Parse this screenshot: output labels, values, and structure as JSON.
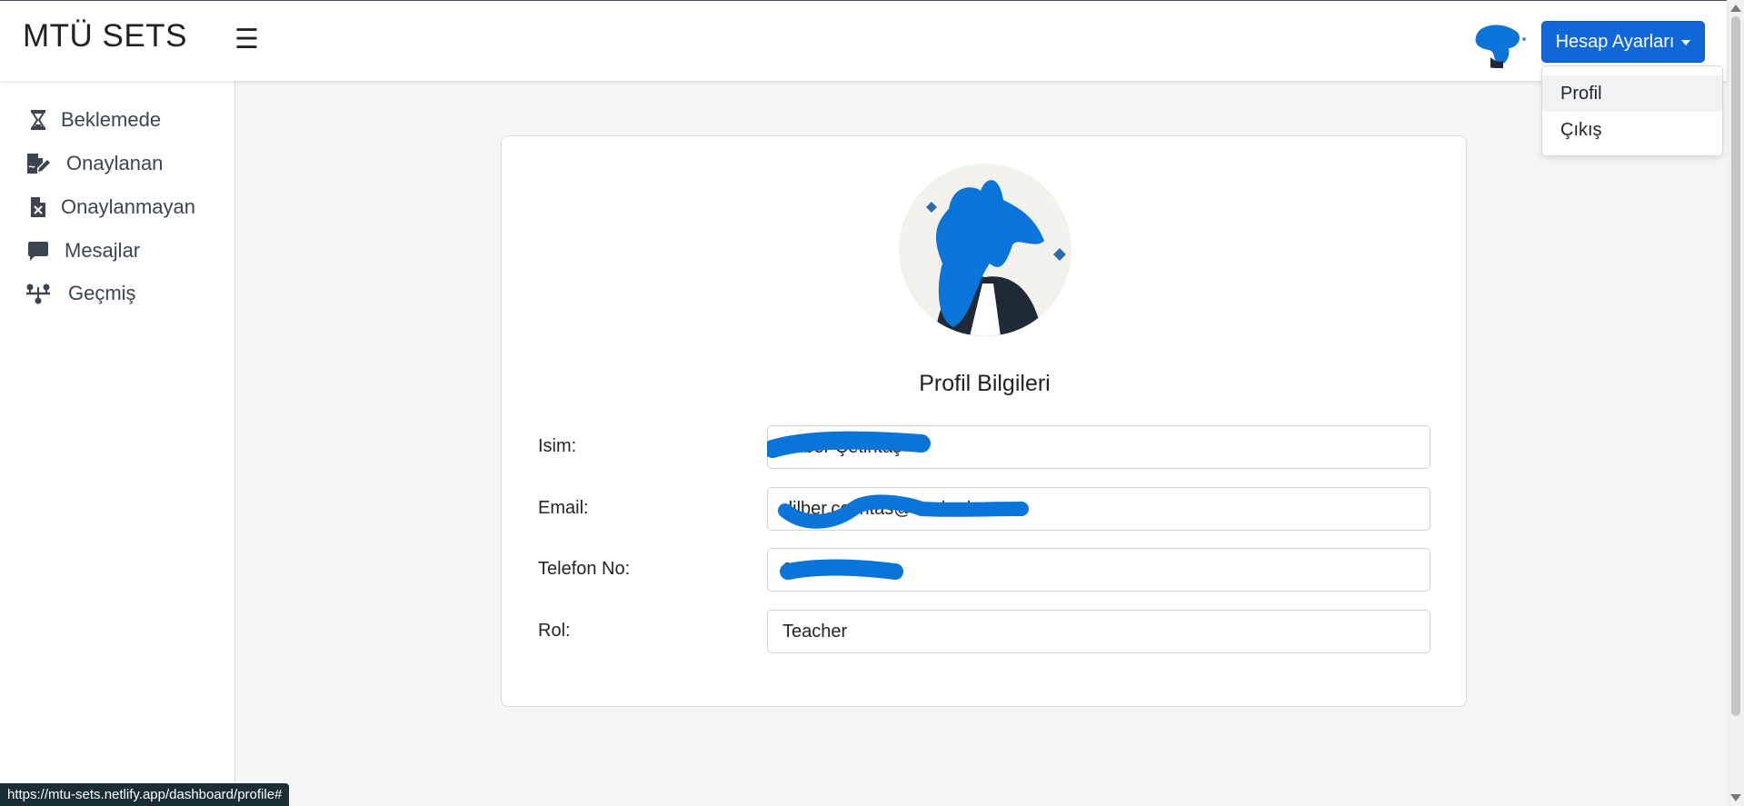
{
  "header": {
    "brand": "MTÜ SETS",
    "menu_icon": "☰",
    "account_button_label": "Hesap Ayarları"
  },
  "dropdown": {
    "items": [
      {
        "label": "Profil"
      },
      {
        "label": "Çıkış"
      }
    ]
  },
  "sidebar": {
    "items": [
      {
        "label": "Beklemede",
        "icon": "hourglass-icon"
      },
      {
        "label": "Onaylanan",
        "icon": "file-signature-icon"
      },
      {
        "label": "Onaylanmayan",
        "icon": "file-excel-icon"
      },
      {
        "label": "Mesajlar",
        "icon": "message-icon"
      },
      {
        "label": "Geçmiş",
        "icon": "timeline-icon"
      }
    ]
  },
  "profile": {
    "title": "Profil Bilgileri",
    "fields": [
      {
        "label": "Isim:",
        "value": "Dilber Çetintaş"
      },
      {
        "label": "Email:",
        "value": "dilber.cetintas@ozal.edu.tr"
      },
      {
        "label": "Telefon No:",
        "value": "05xxxxxxxx2"
      },
      {
        "label": "Rol:",
        "value": "Teacher"
      }
    ]
  },
  "status_bar": {
    "url": "https://mtu-sets.netlify.app/dashboard/profile#"
  },
  "colors": {
    "primary": "#1166d8",
    "redaction": "#0a74d9",
    "statusbar": "#1a2e35"
  }
}
